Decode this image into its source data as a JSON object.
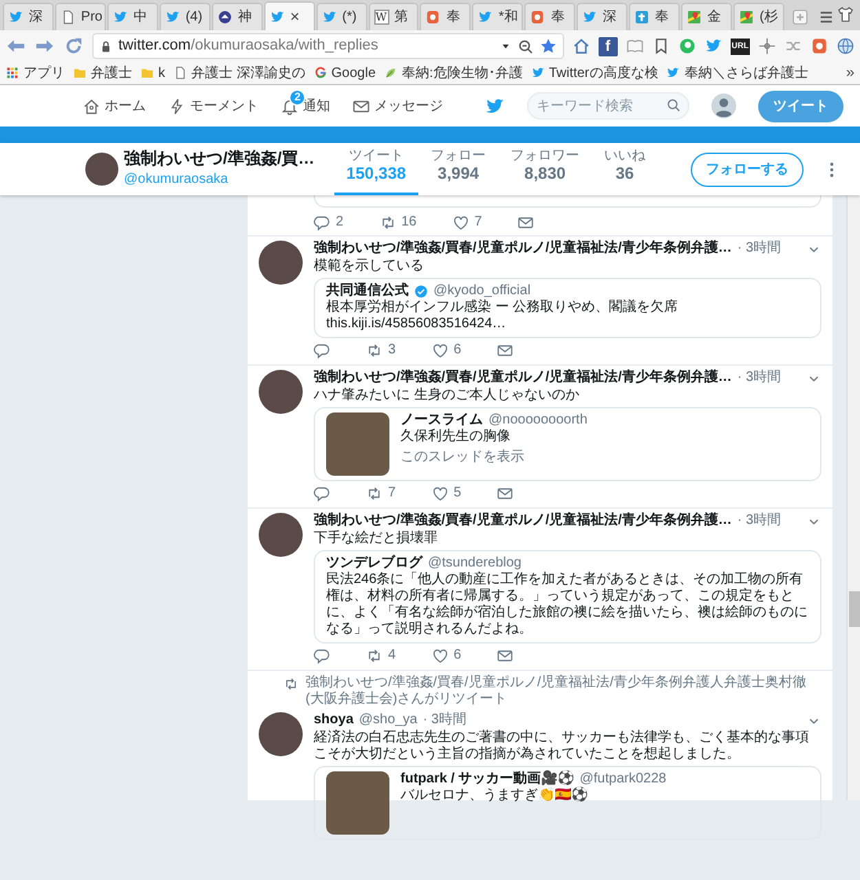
{
  "browser": {
    "tabs": [
      {
        "kind": "twitter",
        "label": "深",
        "selected": false
      },
      {
        "kind": "page",
        "label": "Pro",
        "selected": false
      },
      {
        "kind": "twitter",
        "label": "中",
        "selected": false
      },
      {
        "kind": "twitter",
        "label": "(4)",
        "selected": false
      },
      {
        "kind": "site",
        "label": "神",
        "selected": false
      },
      {
        "kind": "twitter",
        "close": "×",
        "selected": true
      },
      {
        "kind": "twitter",
        "label": "(*)",
        "selected": false
      },
      {
        "kind": "wiki",
        "icon_text": "W",
        "label": "第",
        "selected": false
      },
      {
        "kind": "fox",
        "label": "奉",
        "selected": false
      },
      {
        "kind": "twitter",
        "label": "*和",
        "selected": false
      },
      {
        "kind": "fox",
        "label": "奉",
        "selected": false
      },
      {
        "kind": "twitter",
        "label": "深",
        "selected": false
      },
      {
        "kind": "blog",
        "label": "奉",
        "selected": false
      },
      {
        "kind": "maps",
        "label": "金",
        "selected": false
      },
      {
        "kind": "maps",
        "label": "(杉",
        "selected": false
      }
    ],
    "url": {
      "host": "twitter.com",
      "path": "/okumuraosaka/with_replies"
    },
    "toolbar": [
      {
        "kind": "home"
      },
      {
        "kind": "facebook",
        "text": "f"
      },
      {
        "kind": "reader"
      },
      {
        "kind": "bookmark"
      },
      {
        "kind": "evernote"
      },
      {
        "kind": "twitter"
      },
      {
        "kind": "url",
        "text": "URL"
      },
      {
        "kind": "move"
      },
      {
        "kind": "shuffle"
      },
      {
        "kind": "fox"
      },
      {
        "kind": "globe"
      }
    ],
    "bookmarks": [
      {
        "kind": "apps",
        "label": "アプリ"
      },
      {
        "kind": "folder",
        "label": "弁護士"
      },
      {
        "kind": "folder",
        "label": "k"
      },
      {
        "kind": "page",
        "label": "弁護士 深澤諭史の"
      },
      {
        "kind": "google",
        "label": "Google"
      },
      {
        "kind": "leaf",
        "label": "奉納:危険生物･弁護"
      },
      {
        "kind": "twitter",
        "label": "Twitterの高度な検"
      },
      {
        "kind": "twitter",
        "label": "奉納＼さらば弁護士"
      }
    ],
    "bookmarks_more": "»"
  },
  "nav": {
    "items": [
      {
        "kind": "home",
        "label": "ホーム"
      },
      {
        "kind": "moments",
        "label": "モーメント"
      },
      {
        "kind": "notifications",
        "label": "通知",
        "badge": "2"
      },
      {
        "kind": "messages",
        "label": "メッセージ"
      }
    ],
    "search": {
      "placeholder": "キーワード検索"
    },
    "tweet_button": "ツイート"
  },
  "profile": {
    "name": "強制わいせつ/準強姦/買…",
    "handle": "@okumuraosaka",
    "stats": [
      {
        "label": "ツイート",
        "value": "150,338",
        "selected": true
      },
      {
        "label": "フォロー",
        "value": "3,994",
        "selected": false
      },
      {
        "label": "フォロワー",
        "value": "8,830",
        "selected": false
      },
      {
        "label": "いいね",
        "value": "36",
        "selected": false
      }
    ],
    "follow_button": "フォローする"
  },
  "timeline": {
    "partial_tweet": {
      "actions": {
        "reply": "2",
        "retweet": "16",
        "like": "7"
      }
    },
    "tweets": [
      {
        "name": "強制わいせつ/準強姦/買春/児童ポルノ/児童福祉法/青少年条例弁護…",
        "time": "· 3時間",
        "text": "模範を示している",
        "quote": {
          "kind": "text",
          "author": "共同通信公式",
          "verified": true,
          "handle": "@kyodo_official",
          "text": "根本厚労相がインフル感染 ー 公務取りやめ、閣議を欠席",
          "link": "this.kiji.is/45856083516424…"
        },
        "actions": {
          "retweet": "3",
          "like": "6"
        }
      },
      {
        "name": "強制わいせつ/準強姦/買春/児童ポルノ/児童福祉法/青少年条例弁護…",
        "time": "· 3時間",
        "text": "ハナ肇みたいに 生身のご本人じゃないのか",
        "quote": {
          "kind": "photo",
          "author": "ノースライム",
          "verified": false,
          "handle": "@noooooooorth",
          "text": "久保利先生の胸像",
          "link": "このスレッドを表示"
        },
        "actions": {
          "retweet": "7",
          "like": "5"
        }
      },
      {
        "name": "強制わいせつ/準強姦/買春/児童ポルノ/児童福祉法/青少年条例弁護…",
        "time": "· 3時間",
        "text": "下手な絵だと損壊罪",
        "quote": {
          "kind": "text",
          "author": "ツンデレブログ",
          "verified": false,
          "handle": "@tsundereblog",
          "text": "民法246条に「他人の動産に工作を加えた者があるときは、その加工物の所有権は、材料の所有者に帰属する。」っていう規定があって、この規定をもとに、よく「有名な絵師が宿泊した旅館の襖に絵を描いたら、襖は絵師のものになる」って説明されるんだよね。"
        },
        "actions": {
          "retweet": "4",
          "like": "6"
        }
      },
      {
        "retweeted_by": "強制わいせつ/準強姦/買春/児童ポルノ/児童福祉法/青少年条例弁護人弁護士奥村徹(大阪弁護士会)さんがリツイート",
        "name": "shoya",
        "handle": "@sho_ya",
        "time": "· 3時間",
        "text": "経済法の白石忠志先生のご著書の中に、サッカーも法律学も、ごく基本的な事項こそが大切だという主旨の指摘が為されていたことを想起しました。",
        "quote": {
          "kind": "photo",
          "author": "futpark / サッカー動画🎥⚽",
          "verified": false,
          "handle": "@futpark0228",
          "text": "バルセロナ、うますぎ👏🇪🇸⚽"
        }
      }
    ]
  }
}
